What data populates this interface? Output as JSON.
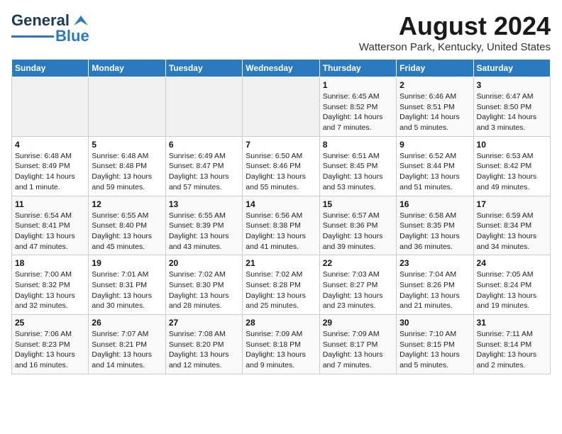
{
  "logo": {
    "line1": "General",
    "line2": "Blue"
  },
  "title": "August 2024",
  "subtitle": "Watterson Park, Kentucky, United States",
  "days_of_week": [
    "Sunday",
    "Monday",
    "Tuesday",
    "Wednesday",
    "Thursday",
    "Friday",
    "Saturday"
  ],
  "weeks": [
    [
      {
        "day": "",
        "info": ""
      },
      {
        "day": "",
        "info": ""
      },
      {
        "day": "",
        "info": ""
      },
      {
        "day": "",
        "info": ""
      },
      {
        "day": "1",
        "info": "Sunrise: 6:45 AM\nSunset: 8:52 PM\nDaylight: 14 hours\nand 7 minutes."
      },
      {
        "day": "2",
        "info": "Sunrise: 6:46 AM\nSunset: 8:51 PM\nDaylight: 14 hours\nand 5 minutes."
      },
      {
        "day": "3",
        "info": "Sunrise: 6:47 AM\nSunset: 8:50 PM\nDaylight: 14 hours\nand 3 minutes."
      }
    ],
    [
      {
        "day": "4",
        "info": "Sunrise: 6:48 AM\nSunset: 8:49 PM\nDaylight: 14 hours\nand 1 minute."
      },
      {
        "day": "5",
        "info": "Sunrise: 6:48 AM\nSunset: 8:48 PM\nDaylight: 13 hours\nand 59 minutes."
      },
      {
        "day": "6",
        "info": "Sunrise: 6:49 AM\nSunset: 8:47 PM\nDaylight: 13 hours\nand 57 minutes."
      },
      {
        "day": "7",
        "info": "Sunrise: 6:50 AM\nSunset: 8:46 PM\nDaylight: 13 hours\nand 55 minutes."
      },
      {
        "day": "8",
        "info": "Sunrise: 6:51 AM\nSunset: 8:45 PM\nDaylight: 13 hours\nand 53 minutes."
      },
      {
        "day": "9",
        "info": "Sunrise: 6:52 AM\nSunset: 8:44 PM\nDaylight: 13 hours\nand 51 minutes."
      },
      {
        "day": "10",
        "info": "Sunrise: 6:53 AM\nSunset: 8:42 PM\nDaylight: 13 hours\nand 49 minutes."
      }
    ],
    [
      {
        "day": "11",
        "info": "Sunrise: 6:54 AM\nSunset: 8:41 PM\nDaylight: 13 hours\nand 47 minutes."
      },
      {
        "day": "12",
        "info": "Sunrise: 6:55 AM\nSunset: 8:40 PM\nDaylight: 13 hours\nand 45 minutes."
      },
      {
        "day": "13",
        "info": "Sunrise: 6:55 AM\nSunset: 8:39 PM\nDaylight: 13 hours\nand 43 minutes."
      },
      {
        "day": "14",
        "info": "Sunrise: 6:56 AM\nSunset: 8:38 PM\nDaylight: 13 hours\nand 41 minutes."
      },
      {
        "day": "15",
        "info": "Sunrise: 6:57 AM\nSunset: 8:36 PM\nDaylight: 13 hours\nand 39 minutes."
      },
      {
        "day": "16",
        "info": "Sunrise: 6:58 AM\nSunset: 8:35 PM\nDaylight: 13 hours\nand 36 minutes."
      },
      {
        "day": "17",
        "info": "Sunrise: 6:59 AM\nSunset: 8:34 PM\nDaylight: 13 hours\nand 34 minutes."
      }
    ],
    [
      {
        "day": "18",
        "info": "Sunrise: 7:00 AM\nSunset: 8:32 PM\nDaylight: 13 hours\nand 32 minutes."
      },
      {
        "day": "19",
        "info": "Sunrise: 7:01 AM\nSunset: 8:31 PM\nDaylight: 13 hours\nand 30 minutes."
      },
      {
        "day": "20",
        "info": "Sunrise: 7:02 AM\nSunset: 8:30 PM\nDaylight: 13 hours\nand 28 minutes."
      },
      {
        "day": "21",
        "info": "Sunrise: 7:02 AM\nSunset: 8:28 PM\nDaylight: 13 hours\nand 25 minutes."
      },
      {
        "day": "22",
        "info": "Sunrise: 7:03 AM\nSunset: 8:27 PM\nDaylight: 13 hours\nand 23 minutes."
      },
      {
        "day": "23",
        "info": "Sunrise: 7:04 AM\nSunset: 8:26 PM\nDaylight: 13 hours\nand 21 minutes."
      },
      {
        "day": "24",
        "info": "Sunrise: 7:05 AM\nSunset: 8:24 PM\nDaylight: 13 hours\nand 19 minutes."
      }
    ],
    [
      {
        "day": "25",
        "info": "Sunrise: 7:06 AM\nSunset: 8:23 PM\nDaylight: 13 hours\nand 16 minutes."
      },
      {
        "day": "26",
        "info": "Sunrise: 7:07 AM\nSunset: 8:21 PM\nDaylight: 13 hours\nand 14 minutes."
      },
      {
        "day": "27",
        "info": "Sunrise: 7:08 AM\nSunset: 8:20 PM\nDaylight: 13 hours\nand 12 minutes."
      },
      {
        "day": "28",
        "info": "Sunrise: 7:09 AM\nSunset: 8:18 PM\nDaylight: 13 hours\nand 9 minutes."
      },
      {
        "day": "29",
        "info": "Sunrise: 7:09 AM\nSunset: 8:17 PM\nDaylight: 13 hours\nand 7 minutes."
      },
      {
        "day": "30",
        "info": "Sunrise: 7:10 AM\nSunset: 8:15 PM\nDaylight: 13 hours\nand 5 minutes."
      },
      {
        "day": "31",
        "info": "Sunrise: 7:11 AM\nSunset: 8:14 PM\nDaylight: 13 hours\nand 2 minutes."
      }
    ]
  ]
}
